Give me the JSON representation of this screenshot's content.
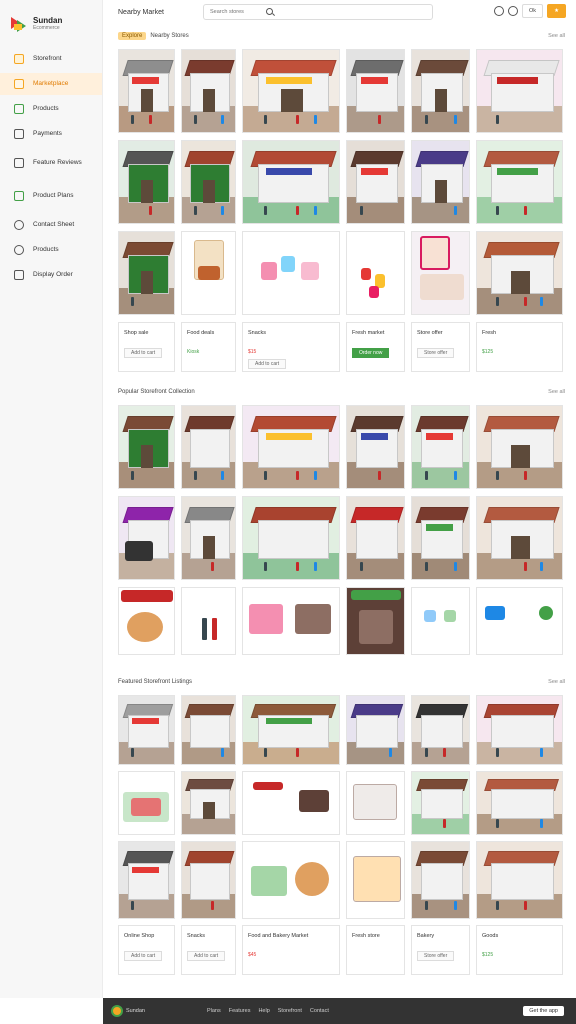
{
  "brand": {
    "name": "Sundan",
    "subtitle": "Ecommerce"
  },
  "header": {
    "title": "Nearby Market",
    "search_placeholder": "Search stores",
    "btn_secondary": "Ok",
    "btn_primary": "★"
  },
  "sidebar": {
    "items": [
      {
        "label": "Storefront"
      },
      {
        "label": "Marketplace"
      },
      {
        "label": "Products"
      },
      {
        "label": "Payments"
      },
      {
        "label": "Feature Reviews"
      },
      {
        "label": "Product Plans"
      },
      {
        "label": "Contact Sheet"
      },
      {
        "label": "Products"
      },
      {
        "label": "Display Order"
      }
    ]
  },
  "sections": [
    {
      "chip": "Explore",
      "tab": "Nearby Stores",
      "link": "See all",
      "cards": [
        {
          "title": "Shop sale",
          "meta": "",
          "button": "Add to cart"
        },
        {
          "title": "Food deals",
          "meta": "Kiosk",
          "button": ""
        },
        {
          "title": "Snacks",
          "meta": "$15",
          "button": "Add to cart"
        },
        {
          "title": "Fresh market",
          "meta": "",
          "button": "Order now"
        },
        {
          "title": "Store offer",
          "meta": "",
          "button": "Store offer"
        },
        {
          "title": "Fresh",
          "meta": "$125",
          "button": ""
        }
      ]
    },
    {
      "chip": "",
      "tab": "Popular Storefront Collection",
      "link": "See all",
      "cards": []
    },
    {
      "chip": "",
      "tab": "Featured Storefront Listings",
      "link": "See all",
      "cards": [
        {
          "title": "Online Shop",
          "meta": "",
          "button": "Add to cart"
        },
        {
          "title": "Snacks",
          "meta": "",
          "button": "Add to cart"
        },
        {
          "title": "Food and Bakery Market",
          "meta": "$45",
          "button": ""
        },
        {
          "title": "Fresh store",
          "meta": "",
          "button": ""
        },
        {
          "title": "Bakery",
          "meta": "",
          "button": "Store offer"
        },
        {
          "title": "Goods",
          "meta": "$125",
          "button": ""
        }
      ]
    }
  ],
  "footer": {
    "brand": "Sundan",
    "links": [
      "Plans",
      "Features",
      "Help",
      "Storefront",
      "Contact"
    ],
    "button": "Get the app"
  },
  "colors": {
    "accent": "#f5a623",
    "brand_green": "#43a047",
    "brand_red": "#e53935"
  },
  "icons": [
    "storefront-icon",
    "market-icon",
    "products-icon",
    "payments-icon",
    "reviews-icon",
    "plans-icon",
    "contact-icon",
    "box-icon",
    "order-icon",
    "search-icon",
    "bell-icon",
    "settings-icon"
  ]
}
